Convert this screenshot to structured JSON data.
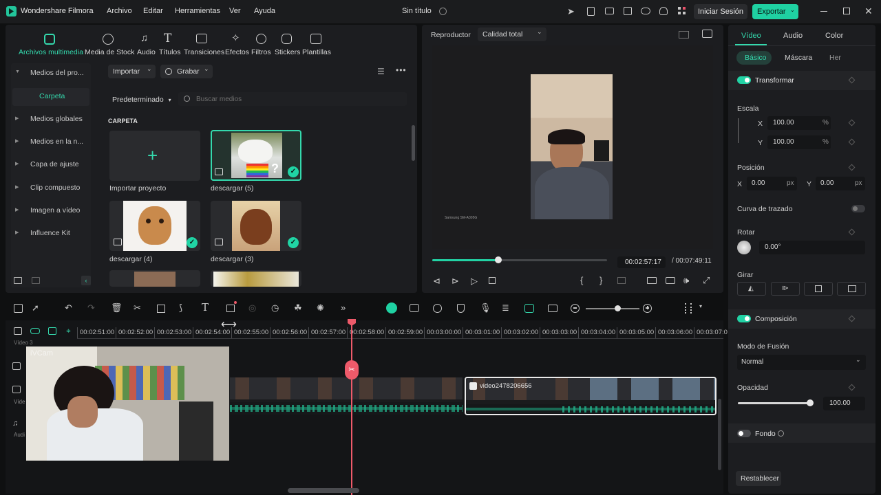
{
  "app": {
    "name": "Wondershare Filmora",
    "doc_title": "Sin título",
    "menu": [
      "Archivo",
      "Editar",
      "Herramientas",
      "Ver",
      "Ayuda"
    ],
    "login_label": "Iniciar Sesión",
    "export_label": "Exportar"
  },
  "media_tabs": [
    {
      "label": "Archivos multimedia",
      "icon": "media-icon",
      "active": true
    },
    {
      "label": "Media de Stock",
      "icon": "stock-icon"
    },
    {
      "label": "Audio",
      "icon": "music-note-icon"
    },
    {
      "label": "Títulos",
      "icon": "text-t-icon"
    },
    {
      "label": "Transiciones",
      "icon": "transition-icon"
    },
    {
      "label": "Efectos",
      "icon": "effects-icon"
    },
    {
      "label": "Filtros",
      "icon": "filter-icon"
    },
    {
      "label": "Stickers",
      "icon": "sticker-icon"
    },
    {
      "label": "Plantillas",
      "icon": "template-icon"
    }
  ],
  "sidebar": {
    "header": "Medios del pro...",
    "folder": "Carpeta",
    "items": [
      "Medios globales",
      "Medios en la n...",
      "Capa de ajuste",
      "Clip compuesto",
      "Imagen a vídeo",
      "Influence Kit"
    ]
  },
  "media_panel": {
    "import_label": "Importar",
    "record_label": "Grabar",
    "sort_label": "Predeterminado",
    "search_placeholder": "Buscar medios",
    "section_label": "CARPETA",
    "items": [
      {
        "label": "Importar proyecto"
      },
      {
        "label": "descargar (5)"
      },
      {
        "label": "descargar (4)"
      },
      {
        "label": "descargar (3)"
      }
    ]
  },
  "player": {
    "label": "Reproductor",
    "quality": "Calidad total",
    "current_time": "00:02:57:17",
    "total_time": "/ 00:07:49:11",
    "progress": 0.378,
    "watermark": "Samsung SM-A305G"
  },
  "inspector": {
    "tabs": [
      "Vídeo",
      "Audio",
      "Color"
    ],
    "subtabs": [
      "Básico",
      "Máscara",
      "Her"
    ],
    "transform_label": "Transformar",
    "scale_label": "Escala",
    "x_label": "X",
    "y_label": "Y",
    "scale_x": "100.00",
    "scale_y": "100.00",
    "percent": "%",
    "position_label": "Posición",
    "pos_x": "0.00",
    "pos_y": "0.00",
    "px": "px",
    "curve_label": "Curva de trazado",
    "rotate_label": "Rotar",
    "rotate_value": "0.00°",
    "flip_label": "Girar",
    "composition_label": "Composición",
    "blend_label": "Modo de Fusión",
    "blend_value": "Normal",
    "opacity_label": "Opacidad",
    "opacity_value": "100.00",
    "opacity": 1.0,
    "background_label": "Fondo",
    "reset_label": "Restablecer"
  },
  "timeline": {
    "ticks": [
      "00:02:51:00",
      "00:02:52:00",
      "00:02:53:00",
      "00:02:54:00",
      "00:02:55:00",
      "00:02:56:00",
      "00:02:57:00",
      "00:02:58:00",
      "00:02:59:00",
      "00:03:00:00",
      "00:03:01:00",
      "00:03:02:00",
      "00:03:03:00",
      "00:03:04:00",
      "00:03:05:00",
      "00:03:06:00",
      "00:03:07:0"
    ],
    "tracks": {
      "video3": "Vídeo 3",
      "video1": "Víde",
      "audio1": "Audi"
    },
    "clip_name": "video2478206656",
    "webcam_label": "iVCam"
  },
  "colors": {
    "accent": "#1fd1a2",
    "playhead": "#ee5a6a",
    "panel": "#1c1d20",
    "background": "#0f1011"
  }
}
